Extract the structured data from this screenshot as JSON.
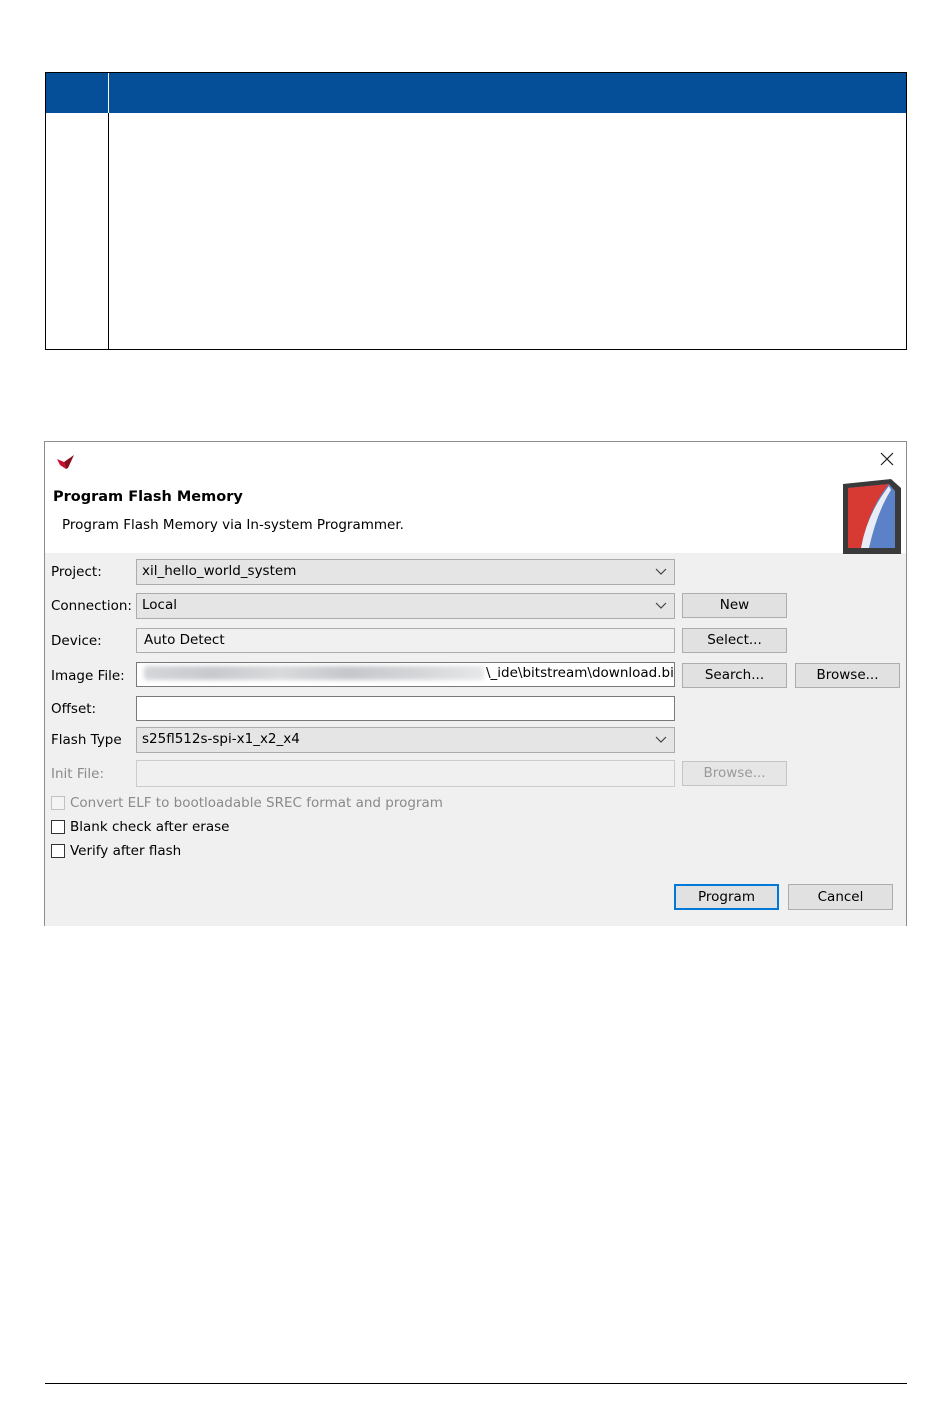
{
  "dialog": {
    "title": "Program Flash Memory",
    "subtitle": "Program Flash Memory via In-system Programmer.",
    "fields": {
      "project": {
        "label": "Project:",
        "value": "xil_hello_world_system"
      },
      "connection": {
        "label": "Connection:",
        "value": "Local"
      },
      "device": {
        "label": "Device:",
        "value": "Auto Detect"
      },
      "image_file": {
        "label": "Image File:",
        "value": "\\_ide\\bitstream\\download.bit"
      },
      "offset": {
        "label": "Offset:",
        "value": ""
      },
      "flash_type": {
        "label": "Flash Type",
        "value": "s25fl512s-spi-x1_x2_x4"
      },
      "init_file": {
        "label": "Init File:",
        "value": ""
      }
    },
    "buttons": {
      "new": "New",
      "select": "Select...",
      "search": "Search...",
      "browse_image": "Browse...",
      "browse_init": "Browse...",
      "program": "Program",
      "cancel": "Cancel"
    },
    "checkboxes": {
      "convert_elf": {
        "label": "Convert ELF to bootloadable SREC format and program",
        "checked": false,
        "enabled": false
      },
      "blank_check": {
        "label": "Blank check after erase",
        "checked": false,
        "enabled": true
      },
      "verify": {
        "label": "Verify after flash",
        "checked": false,
        "enabled": true
      }
    },
    "icons": [
      "app-logo-icon",
      "close-icon",
      "flash-memory-icon",
      "chevron-down-icon"
    ],
    "colors": {
      "header_blue": "#044f97",
      "accent": "#0078d7",
      "logo_red": "#c8102e"
    }
  }
}
